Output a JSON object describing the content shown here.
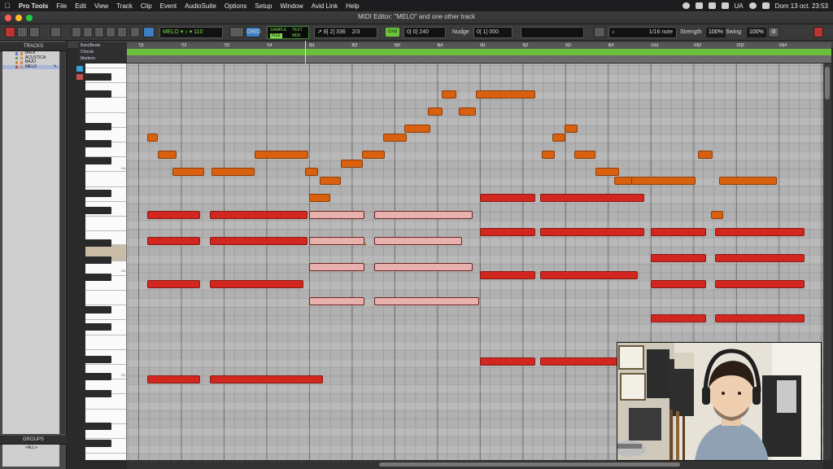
{
  "menubar": {
    "app_name": "Pro Tools",
    "items": [
      "File",
      "Edit",
      "View",
      "Track",
      "Clip",
      "Event",
      "AudioSuite",
      "Options",
      "Setup",
      "Window",
      "Avid Link",
      "Help"
    ],
    "input_source": "UA",
    "clock": "Dom 13 oct.  23:53"
  },
  "window": {
    "title": "MIDI Editor: \"MELO\" and one other track"
  },
  "toolbar": {
    "track_selector": "MELO",
    "velocity_readout": "110",
    "edit_mode": "GRID",
    "counter_mode_a": "SAMPLE",
    "counter_mode_b": "TEXT",
    "counter_flag_a": "FILE",
    "counter_flag_b": "MIDI",
    "position": "8| 2| 336",
    "duration": "2/3",
    "grid_label": "Grid",
    "grid_value": "0| 0| 240",
    "nudge_label": "Nudge",
    "nudge_value": "0| 1| 000",
    "quantize_value": "1/16 note",
    "strength_label": "Strength",
    "strength_value": "100%",
    "swing_label": "Swing",
    "swing_value": "100%"
  },
  "tracks_panel": {
    "header": "TRACKS",
    "tracks": [
      {
        "name": "BATA",
        "color": "#4e7bd8"
      },
      {
        "name": "ACUSTICA",
        "color": "#5a9e4b"
      },
      {
        "name": "BAJO",
        "color": "#d88a2a"
      },
      {
        "name": "MELO",
        "color": "#c84141"
      }
    ],
    "groups_header": "GROUPS",
    "groups": [
      "<ALL>"
    ]
  },
  "editor": {
    "ruler_label": "Bars|Beats",
    "chords_label": "Chords",
    "markers_label": "Markers",
    "bars": [
      "7|1",
      "7|2",
      "7|3",
      "7|4",
      "8|1",
      "8|2",
      "8|3",
      "8|4",
      "9|1",
      "9|2",
      "9|3",
      "9|4",
      "10|1",
      "10|2",
      "10|3",
      "10|4"
    ],
    "octave_labels": [
      "C4",
      "C3",
      "C2"
    ]
  },
  "colors": {
    "melody_note": "#d8600f",
    "chord_note": "#d2271f",
    "selected_note": "#e8b1ae",
    "chord_lane": "#6ac03a",
    "grid_background": "#b1b1b1"
  },
  "notes": [
    {
      "track": "MELO",
      "color": "orange",
      "bar_start": 0.2,
      "beats": 0.25,
      "row": 8
    },
    {
      "track": "MELO",
      "color": "orange",
      "bar_start": 0.45,
      "beats": 0.45,
      "row": 10
    },
    {
      "track": "MELO",
      "color": "orange",
      "bar_start": 0.8,
      "beats": 0.75,
      "row": 12
    },
    {
      "track": "MELO",
      "color": "orange",
      "bar_start": 1.72,
      "beats": 1.0,
      "row": 12
    },
    {
      "track": "MELO",
      "color": "orange",
      "bar_start": 2.73,
      "beats": 1.25,
      "row": 10
    },
    {
      "track": "MELO",
      "color": "orange",
      "bar_start": 3.9,
      "beats": 0.3,
      "row": 12
    },
    {
      "track": "MELO",
      "color": "orange",
      "bar_start": 4.0,
      "beats": 0.5,
      "row": 15
    },
    {
      "track": "MELO",
      "color": "orange",
      "bar_start": 4.25,
      "beats": 0.5,
      "row": 13
    },
    {
      "track": "MELO",
      "color": "orange",
      "bar_start": 4.75,
      "beats": 0.5,
      "row": 11
    },
    {
      "track": "MELO",
      "color": "orange",
      "bar_start": 5.23,
      "beats": 0.55,
      "row": 10
    },
    {
      "track": "MELO",
      "color": "orange",
      "bar_start": 5.73,
      "beats": 0.55,
      "row": 8
    },
    {
      "track": "MELO",
      "color": "orange",
      "bar_start": 6.23,
      "beats": 0.6,
      "row": 7
    },
    {
      "track": "MELO",
      "color": "orange",
      "bar_start": 6.78,
      "beats": 0.35,
      "row": 5
    },
    {
      "track": "MELO",
      "color": "orange",
      "bar_start": 7.1,
      "beats": 0.35,
      "row": 3
    },
    {
      "track": "MELO",
      "color": "orange",
      "bar_start": 7.5,
      "beats": 0.4,
      "row": 5
    },
    {
      "track": "MELO",
      "color": "orange",
      "bar_start": 7.9,
      "beats": 1.4,
      "row": 3
    },
    {
      "track": "MELO",
      "color": "orange",
      "bar_start": 9.45,
      "beats": 0.3,
      "row": 10
    },
    {
      "track": "MELO",
      "color": "orange",
      "bar_start": 9.7,
      "beats": 0.3,
      "row": 8
    },
    {
      "track": "MELO",
      "color": "orange",
      "bar_start": 9.98,
      "beats": 0.3,
      "row": 7
    },
    {
      "track": "MELO",
      "color": "orange",
      "bar_start": 10.2,
      "beats": 0.5,
      "row": 10
    },
    {
      "track": "MELO",
      "color": "orange",
      "bar_start": 10.7,
      "beats": 0.55,
      "row": 12
    },
    {
      "track": "MELO",
      "color": "orange",
      "bar_start": 11.15,
      "beats": 0.45,
      "row": 13
    },
    {
      "track": "MELO",
      "color": "orange",
      "bar_start": 11.55,
      "beats": 1.5,
      "row": 13
    },
    {
      "track": "MELO",
      "color": "orange",
      "bar_start": 13.1,
      "beats": 0.35,
      "row": 10
    },
    {
      "track": "MELO",
      "color": "orange",
      "bar_start": 13.4,
      "beats": 0.3,
      "row": 17
    },
    {
      "track": "MELO",
      "color": "orange",
      "bar_start": 13.6,
      "beats": 1.35,
      "row": 13
    },
    {
      "track": "MELO",
      "color": "red",
      "bar_start": 0.2,
      "beats": 1.25,
      "row": 17
    },
    {
      "track": "MELO",
      "color": "red",
      "bar_start": 0.2,
      "beats": 1.25,
      "row": 20
    },
    {
      "track": "MELO",
      "color": "red",
      "bar_start": 0.2,
      "beats": 1.25,
      "row": 25
    },
    {
      "track": "MELO",
      "color": "red",
      "bar_start": 0.2,
      "beats": 1.25,
      "row": 36
    },
    {
      "track": "MELO",
      "color": "red",
      "bar_start": 1.67,
      "beats": 2.3,
      "row": 17
    },
    {
      "track": "MELO",
      "color": "red",
      "bar_start": 1.67,
      "beats": 2.3,
      "row": 20
    },
    {
      "track": "MELO",
      "color": "red",
      "bar_start": 1.67,
      "beats": 2.2,
      "row": 25
    },
    {
      "track": "MELO",
      "color": "red",
      "bar_start": 1.67,
      "beats": 2.65,
      "row": 36
    },
    {
      "track": "MELO",
      "color": "selected",
      "bar_start": 4.0,
      "beats": 1.3,
      "row": 17
    },
    {
      "track": "MELO",
      "color": "selected",
      "bar_start": 4.0,
      "beats": 1.3,
      "row": 20
    },
    {
      "track": "MELO",
      "color": "selected",
      "bar_start": 4.0,
      "beats": 1.3,
      "row": 23
    },
    {
      "track": "MELO",
      "color": "selected",
      "bar_start": 4.0,
      "beats": 1.3,
      "row": 27
    },
    {
      "track": "MELO",
      "color": "selected",
      "bar_start": 5.53,
      "beats": 2.3,
      "row": 17
    },
    {
      "track": "MELO",
      "color": "selected",
      "bar_start": 5.53,
      "beats": 2.05,
      "row": 20
    },
    {
      "track": "MELO",
      "color": "selected",
      "bar_start": 5.53,
      "beats": 2.3,
      "row": 23
    },
    {
      "track": "MELO",
      "color": "selected",
      "bar_start": 5.53,
      "beats": 2.45,
      "row": 27
    },
    {
      "track": "MELO",
      "color": "red",
      "bar_start": 8.0,
      "beats": 1.3,
      "row": 15
    },
    {
      "track": "MELO",
      "color": "red",
      "bar_start": 8.0,
      "beats": 1.3,
      "row": 19
    },
    {
      "track": "MELO",
      "color": "red",
      "bar_start": 8.0,
      "beats": 1.3,
      "row": 24
    },
    {
      "track": "MELO",
      "color": "red",
      "bar_start": 8.0,
      "beats": 1.3,
      "row": 34
    },
    {
      "track": "MELO",
      "color": "red",
      "bar_start": 9.4,
      "beats": 2.45,
      "row": 15
    },
    {
      "track": "MELO",
      "color": "red",
      "bar_start": 9.4,
      "beats": 2.45,
      "row": 19
    },
    {
      "track": "MELO",
      "color": "red",
      "bar_start": 9.4,
      "beats": 2.3,
      "row": 24
    },
    {
      "track": "MELO",
      "color": "red",
      "bar_start": 9.4,
      "beats": 1.85,
      "row": 34
    },
    {
      "track": "MELO",
      "color": "red",
      "bar_start": 12.0,
      "beats": 1.3,
      "row": 19
    },
    {
      "track": "MELO",
      "color": "red",
      "bar_start": 12.0,
      "beats": 1.3,
      "row": 22
    },
    {
      "track": "MELO",
      "color": "red",
      "bar_start": 12.0,
      "beats": 1.3,
      "row": 25
    },
    {
      "track": "MELO",
      "color": "red",
      "bar_start": 12.0,
      "beats": 1.3,
      "row": 29
    },
    {
      "track": "MELO",
      "color": "red",
      "bar_start": 13.5,
      "beats": 2.1,
      "row": 19
    },
    {
      "track": "MELO",
      "color": "red",
      "bar_start": 13.5,
      "beats": 2.1,
      "row": 22
    },
    {
      "track": "MELO",
      "color": "red",
      "bar_start": 13.5,
      "beats": 2.1,
      "row": 25
    },
    {
      "track": "MELO",
      "color": "red",
      "bar_start": 13.5,
      "beats": 2.1,
      "row": 29
    }
  ]
}
